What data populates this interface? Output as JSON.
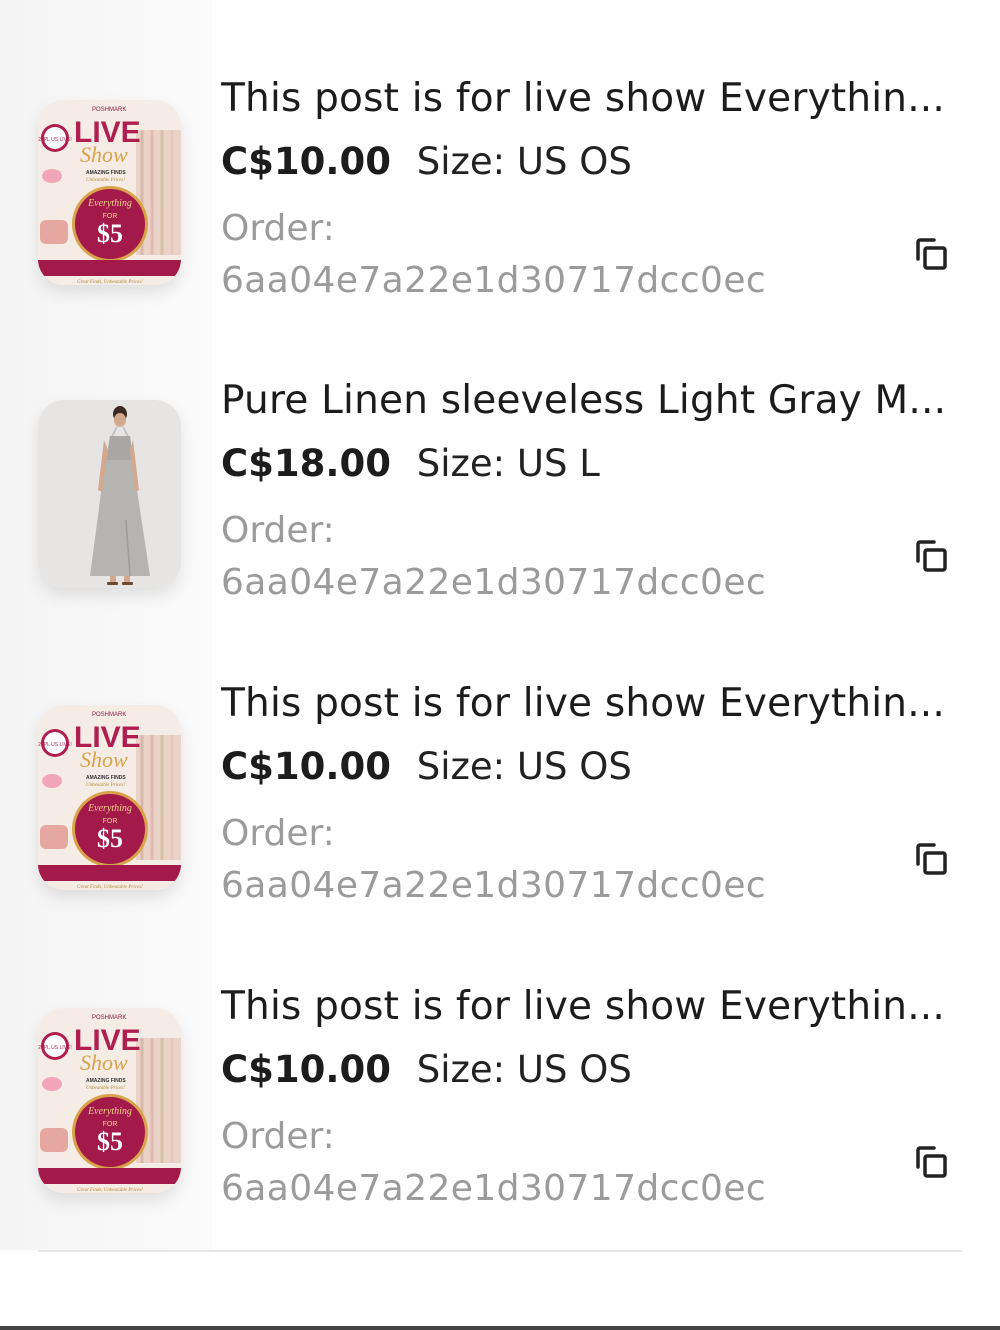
{
  "orders": [
    {
      "title": "This post is for live show Everythin...",
      "price": "C$10.00",
      "size_label": "Size:",
      "size_value": "US OS",
      "order_label": "Order:",
      "order_id": "6aa04e7a22e1d30717dcc0ec",
      "thumb": "live-show"
    },
    {
      "title": "Pure Linen sleeveless Light Gray M...",
      "price": "C$18.00",
      "size_label": "Size:",
      "size_value": "US L",
      "order_label": "Order:",
      "order_id": "6aa04e7a22e1d30717dcc0ec",
      "thumb": "linen-dress"
    },
    {
      "title": "This post is for live show Everythin...",
      "price": "C$10.00",
      "size_label": "Size:",
      "size_value": "US OS",
      "order_label": "Order:",
      "order_id": "6aa04e7a22e1d30717dcc0ec",
      "thumb": "live-show"
    },
    {
      "title": "This post is for live show Everythin...",
      "price": "C$10.00",
      "size_label": "Size:",
      "size_value": "US OS",
      "order_label": "Order:",
      "order_id": "6aa04e7a22e1d30717dcc0ec",
      "thumb": "live-show"
    }
  ],
  "live_thumb": {
    "brand": "POSHMARK",
    "live": "LIVE",
    "show": "Show",
    "badge": "20PL US LIVE!",
    "amazing": "AMAZING FINDS",
    "unbeatable": "Unbeatable Prices!",
    "everything": "Everything",
    "for": "FOR",
    "price": "$5",
    "footer": "Great Finds, Unbeatable Prices!",
    "accent": "#b01e4f"
  },
  "colors": {
    "text": "#1c1c1c",
    "muted": "#9b9b9b",
    "divider": "#e6e6e6"
  },
  "icons": {
    "copy": "copy-icon"
  }
}
